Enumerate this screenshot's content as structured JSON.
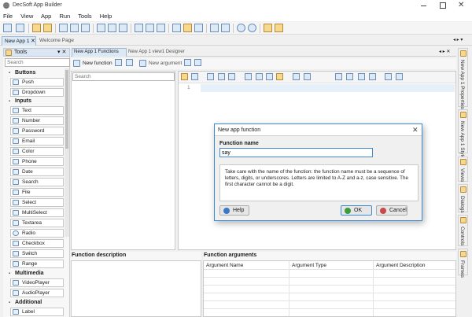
{
  "window": {
    "title": "DecSoft App Builder"
  },
  "menu": [
    "File",
    "View",
    "App",
    "Run",
    "Tools",
    "Help"
  ],
  "tabs": {
    "doc_tabs": [
      "New App 1",
      "Welcome Page"
    ],
    "editor_tabs": [
      "New App 1 Functions",
      "New App 1 view1 Designer"
    ]
  },
  "tools_panel": {
    "title": "Tools",
    "search_placeholder": "Search",
    "categories": [
      {
        "name": "Buttons",
        "items": [
          "Push",
          "Dropdown"
        ]
      },
      {
        "name": "Inputs",
        "items": [
          "Text",
          "Number",
          "Password",
          "Email",
          "Color",
          "Phone",
          "Date",
          "Search",
          "File",
          "Select",
          "MultiSelect",
          "Textarea",
          "Radio",
          "Checkbox",
          "Switch",
          "Range"
        ]
      },
      {
        "name": "Multimedia",
        "items": [
          "VideoPlayer",
          "AudioPlayer"
        ]
      },
      {
        "name": "Additional",
        "items": [
          "Label"
        ]
      }
    ]
  },
  "functions_toolbar": {
    "new_function": "New function",
    "new_argument": "New argument"
  },
  "functions_search_placeholder": "Search",
  "editor": {
    "line_number": "1"
  },
  "bottom": {
    "description_title": "Function description",
    "arguments_title": "Function arguments",
    "columns": [
      "Argument Name",
      "Argument Type",
      "Argument Description"
    ]
  },
  "right_tabs": [
    "New App 1 Properties",
    "New App 1 Style",
    "Views",
    "Dialogs",
    "Controls",
    "Frames"
  ],
  "dialog": {
    "title": "New app function",
    "name_label": "Function name",
    "name_value": "say",
    "info": "Take care with the name of the function: the function name must be a sequence of letters, digits, or underscores. Letters are limited to A-Z and a-z, case sensitive. The first character cannot be a digit.",
    "help_label": "Help",
    "ok_label": "OK",
    "cancel_label": "Cancel"
  }
}
